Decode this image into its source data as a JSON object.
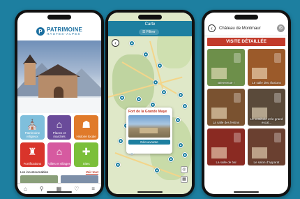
{
  "phone1": {
    "logo": {
      "mark": "P",
      "main": "PATRIMOINE",
      "sub": "HAUTES-ALPES"
    },
    "tiles": [
      {
        "label": "Patrimoine religieux",
        "color": "#7fbfdc",
        "glyph": "⛪"
      },
      {
        "label": "Places et marchés",
        "color": "#6a4b9a",
        "glyph": "⌂"
      },
      {
        "label": "Histoire locale",
        "color": "#e07a2a",
        "glyph": "☗"
      },
      {
        "label": "Fortifications",
        "color": "#d9342b",
        "glyph": "♜"
      },
      {
        "label": "Villes et villages",
        "color": "#d65aa0",
        "glyph": "⌂"
      },
      {
        "label": "Sites",
        "color": "#7bbf3a",
        "glyph": "✚"
      }
    ],
    "section_label": "Les incontournables",
    "see_all": "Voir tout",
    "nav_icons": [
      "home-icon",
      "search-icon",
      "map-icon",
      "heart-icon",
      "menu-icon"
    ],
    "nav_glyphs": [
      "⌂",
      "⚲",
      "▦",
      "♡",
      "≡"
    ]
  },
  "phone2": {
    "header_title": "Carte",
    "filter_label": "Filtrer",
    "popup": {
      "title": "Fort de la Grande Maye",
      "button": "Découvrante"
    }
  },
  "phone3": {
    "title": "Château de Montmaur",
    "banner": "VISITE DÉTAILLÉE",
    "cards": [
      {
        "label": "Bienvenue !",
        "color": "#6d8f4a"
      },
      {
        "label": "Le salle des Illusions",
        "color": "#9b5a2a"
      },
      {
        "label": "La salle des festins",
        "color": "#7a5230"
      },
      {
        "label": "Le vestibule et le grand escal...",
        "color": "#5a4a3a"
      },
      {
        "label": "La salle de bal",
        "color": "#8a2a22"
      },
      {
        "label": "Le salon d'apparat",
        "color": "#6a4030"
      }
    ]
  }
}
